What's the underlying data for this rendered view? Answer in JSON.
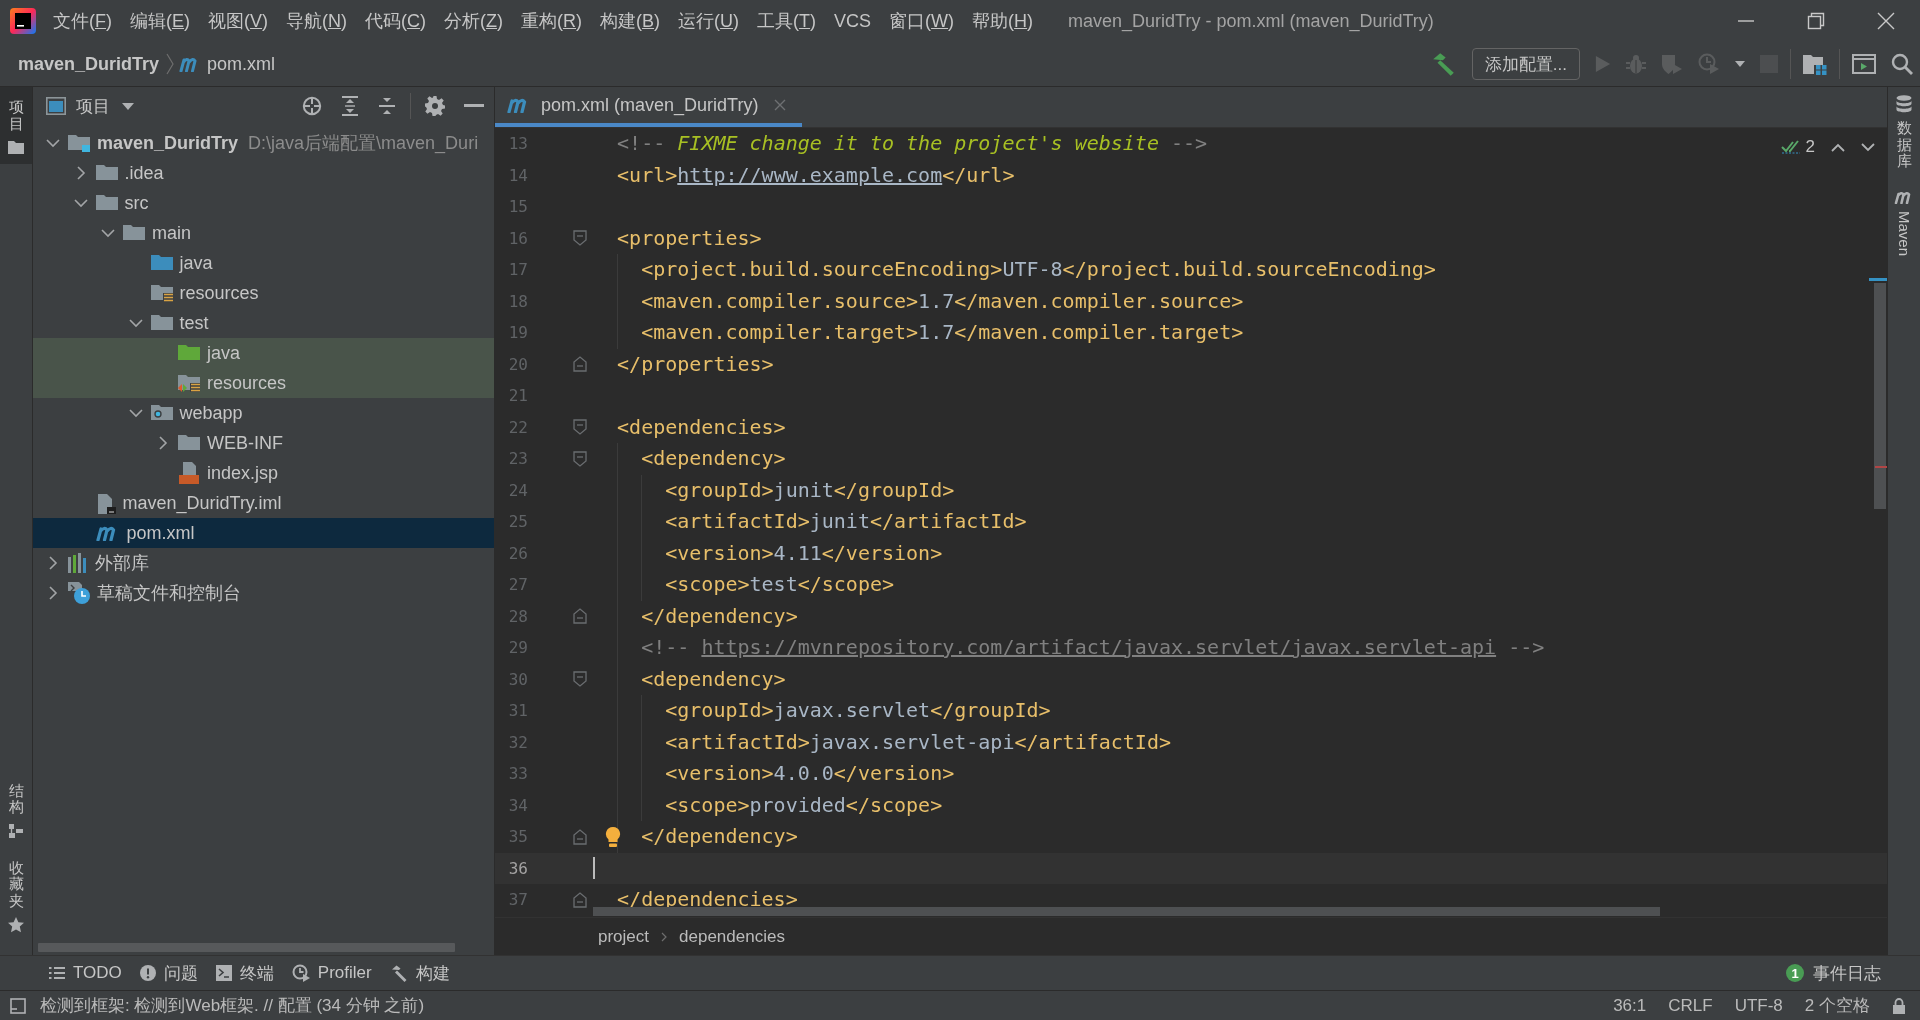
{
  "window": {
    "title": "maven_DuridTry - pom.xml (maven_DuridTry)"
  },
  "menu": [
    {
      "label": "文件(",
      "mnemonic": "F",
      "tail": ")"
    },
    {
      "label": "编辑(",
      "mnemonic": "E",
      "tail": ")"
    },
    {
      "label": "视图(",
      "mnemonic": "V",
      "tail": ")"
    },
    {
      "label": "导航(",
      "mnemonic": "N",
      "tail": ")"
    },
    {
      "label": "代码(",
      "mnemonic": "C",
      "tail": ")"
    },
    {
      "label": "分析(",
      "mnemonic": "Z",
      "tail": ")"
    },
    {
      "label": "重构(",
      "mnemonic": "R",
      "tail": ")"
    },
    {
      "label": "构建(",
      "mnemonic": "B",
      "tail": ")"
    },
    {
      "label": "运行(",
      "mnemonic": "U",
      "tail": ")"
    },
    {
      "label": "工具(",
      "mnemonic": "T",
      "tail": ")"
    },
    {
      "label": "VCS"
    },
    {
      "label": "窗口(",
      "mnemonic": "W",
      "tail": ")"
    },
    {
      "label": "帮助(",
      "mnemonic": "H",
      "tail": ")"
    }
  ],
  "navbar": {
    "breadcrumbs": [
      {
        "label": "maven_DuridTry",
        "kind": "project"
      },
      {
        "label": "pom.xml",
        "kind": "maven"
      }
    ],
    "toolbar_groups": [
      [
        {
          "kind": "build",
          "disabled": false
        },
        {
          "kind": "config",
          "label": "添加配置...",
          "disabled": false
        },
        {
          "kind": "run",
          "disabled": true
        },
        {
          "kind": "debug",
          "disabled": true
        },
        {
          "kind": "coverage",
          "disabled": true
        },
        {
          "kind": "profile",
          "disabled": true
        },
        {
          "kind": "dropdown",
          "disabled": false
        },
        {
          "kind": "stop",
          "disabled": true
        }
      ],
      [
        {
          "kind": "structure",
          "disabled": false
        }
      ],
      [
        {
          "kind": "window",
          "disabled": false
        },
        {
          "kind": "search",
          "disabled": false
        }
      ]
    ]
  },
  "left_strip": {
    "top": [
      {
        "label": "项目",
        "kind": "project",
        "selected": true
      }
    ],
    "bottom": [
      {
        "label": "结构",
        "kind": "structure",
        "selected": false
      },
      {
        "label": "收藏夹",
        "kind": "favorites",
        "selected": false
      }
    ]
  },
  "project_panel": {
    "title": "项目",
    "tool_groups": [
      [
        {
          "kind": "locate"
        },
        {
          "kind": "expand-all"
        },
        {
          "kind": "collapse-all"
        }
      ],
      [
        {
          "kind": "settings"
        },
        {
          "kind": "hide"
        }
      ]
    ],
    "tree": [
      {
        "name": "maven_DuridTry",
        "path": "D:\\java后端配置\\maven_Duri",
        "kind": "module",
        "expanded": true,
        "selected": false,
        "children": [
          {
            "name": ".idea",
            "kind": "folder",
            "expanded": false,
            "selected": false
          },
          {
            "name": "src",
            "kind": "folder",
            "expanded": true,
            "selected": false,
            "children": [
              {
                "name": "main",
                "kind": "folder",
                "expanded": true,
                "selected": false,
                "children": [
                  {
                    "name": "java",
                    "kind": "source-folder",
                    "selected": false
                  },
                  {
                    "name": "resources",
                    "kind": "resources-folder",
                    "selected": false
                  },
                  {
                    "name": "test",
                    "kind": "folder",
                    "expanded": true,
                    "selected": false,
                    "children": [
                      {
                        "name": "java",
                        "kind": "test-source-folder",
                        "selected": false
                      },
                      {
                        "name": "resources",
                        "kind": "test-resources-folder",
                        "selected": false
                      }
                    ]
                  },
                  {
                    "name": "webapp",
                    "kind": "web-folder",
                    "expanded": true,
                    "selected": false,
                    "children": [
                      {
                        "name": "WEB-INF",
                        "kind": "folder",
                        "expanded": false,
                        "selected": false
                      },
                      {
                        "name": "index.jsp",
                        "kind": "jsp",
                        "selected": false
                      }
                    ]
                  }
                ]
              }
            ]
          },
          {
            "name": "maven_DuridTry.iml",
            "kind": "iml",
            "selected": false
          },
          {
            "name": "pom.xml",
            "kind": "maven",
            "selected": true
          }
        ]
      },
      {
        "name": "外部库",
        "kind": "library",
        "expanded": false,
        "selected": false
      },
      {
        "name": "草稿文件和控制台",
        "kind": "scratches",
        "expanded": false,
        "selected": false
      }
    ]
  },
  "editor": {
    "tabs": [
      {
        "label": "pom.xml (maven_DuridTry)",
        "kind": "maven",
        "selected": true
      }
    ],
    "inspection": {
      "count": "2"
    },
    "lines": [
      {
        "number": "13",
        "current": false,
        "tokens": [
          {
            "kind": "comment",
            "text": "<!-- "
          },
          {
            "kind": "todo",
            "text": "FIXME change it to the project's website"
          },
          {
            "kind": "comment",
            "text": " -->"
          }
        ]
      },
      {
        "number": "14",
        "current": false,
        "tokens": [
          {
            "kind": "tag",
            "text": "<url>"
          },
          {
            "kind": "link",
            "text": "http://www.example.com"
          },
          {
            "kind": "tag",
            "text": "</url>"
          }
        ]
      },
      {
        "number": "15",
        "current": false
      },
      {
        "number": "16",
        "current": false,
        "gutter": [
          {
            "kind": "fold-start"
          }
        ],
        "tokens": [
          {
            "kind": "tag",
            "text": "<properties>"
          }
        ],
        "children": [
          {
            "number": "17",
            "current": false,
            "tokens": [
              {
                "kind": "tag",
                "text": "<project.build.sourceEncoding>"
              },
              {
                "kind": "text",
                "text": "UTF-8"
              },
              {
                "kind": "tag",
                "text": "</project.build.sourceEncoding>"
              }
            ]
          },
          {
            "number": "18",
            "current": false,
            "tokens": [
              {
                "kind": "tag",
                "text": "<maven.compiler.source>"
              },
              {
                "kind": "text",
                "text": "1.7"
              },
              {
                "kind": "tag",
                "text": "</maven.compiler.source>"
              }
            ]
          },
          {
            "number": "19",
            "current": false,
            "tokens": [
              {
                "kind": "tag",
                "text": "<maven.compiler.target>"
              },
              {
                "kind": "text",
                "text": "1.7"
              },
              {
                "kind": "tag",
                "text": "</maven.compiler.target>"
              }
            ]
          }
        ]
      },
      {
        "number": "20",
        "current": false,
        "gutter": [
          {
            "kind": "fold-end"
          }
        ],
        "tokens": [
          {
            "kind": "tag",
            "text": "</properties>"
          }
        ]
      },
      {
        "number": "21",
        "current": false
      },
      {
        "number": "22",
        "current": false,
        "gutter": [
          {
            "kind": "fold-start"
          }
        ],
        "tokens": [
          {
            "kind": "tag",
            "text": "<dependencies>"
          }
        ],
        "children": [
          {
            "number": "23",
            "current": false,
            "gutter": [
              {
                "kind": "fold-start"
              }
            ],
            "tokens": [
              {
                "kind": "tag",
                "text": "<dependency>"
              }
            ],
            "children": [
              {
                "number": "24",
                "current": false,
                "tokens": [
                  {
                    "kind": "tag",
                    "text": "<groupId>"
                  },
                  {
                    "kind": "text",
                    "text": "junit"
                  },
                  {
                    "kind": "tag",
                    "text": "</groupId>"
                  }
                ]
              },
              {
                "number": "25",
                "current": false,
                "tokens": [
                  {
                    "kind": "tag",
                    "text": "<artifactId>"
                  },
                  {
                    "kind": "text",
                    "text": "junit"
                  },
                  {
                    "kind": "tag",
                    "text": "</artifactId>"
                  }
                ]
              },
              {
                "number": "26",
                "current": false,
                "tokens": [
                  {
                    "kind": "tag",
                    "text": "<version>"
                  },
                  {
                    "kind": "text",
                    "text": "4.11"
                  },
                  {
                    "kind": "tag",
                    "text": "</version>"
                  }
                ]
              },
              {
                "number": "27",
                "current": false,
                "tokens": [
                  {
                    "kind": "tag",
                    "text": "<scope>"
                  },
                  {
                    "kind": "text",
                    "text": "test"
                  },
                  {
                    "kind": "tag",
                    "text": "</scope>"
                  }
                ]
              }
            ]
          },
          {
            "number": "28",
            "current": false,
            "gutter": [
              {
                "kind": "fold-end"
              }
            ],
            "tokens": [
              {
                "kind": "tag",
                "text": "</dependency>"
              }
            ]
          },
          {
            "number": "29",
            "current": false,
            "tokens": [
              {
                "kind": "comment",
                "text": "<!-- "
              },
              {
                "kind": "comment-link",
                "text": "https://mvnrepository.com/artifact/javax.servlet/javax.servlet-api"
              },
              {
                "kind": "comment",
                "text": " -->"
              }
            ]
          },
          {
            "number": "30",
            "current": false,
            "gutter": [
              {
                "kind": "fold-start"
              }
            ],
            "tokens": [
              {
                "kind": "tag",
                "text": "<dependency>"
              }
            ],
            "children": [
              {
                "number": "31",
                "current": false,
                "tokens": [
                  {
                    "kind": "tag",
                    "text": "<groupId>"
                  },
                  {
                    "kind": "text",
                    "text": "javax.servlet"
                  },
                  {
                    "kind": "tag",
                    "text": "</groupId>"
                  }
                ]
              },
              {
                "number": "32",
                "current": false,
                "tokens": [
                  {
                    "kind": "tag",
                    "text": "<artifactId>"
                  },
                  {
                    "kind": "text",
                    "text": "javax.servlet-api"
                  },
                  {
                    "kind": "tag",
                    "text": "</artifactId>"
                  }
                ]
              },
              {
                "number": "33",
                "current": false,
                "tokens": [
                  {
                    "kind": "tag",
                    "text": "<version>"
                  },
                  {
                    "kind": "text",
                    "text": "4.0.0"
                  },
                  {
                    "kind": "tag",
                    "text": "</version>"
                  }
                ]
              },
              {
                "number": "34",
                "current": false,
                "tokens": [
                  {
                    "kind": "tag",
                    "text": "<scope>"
                  },
                  {
                    "kind": "text",
                    "text": "provided"
                  },
                  {
                    "kind": "tag",
                    "text": "</scope>"
                  }
                ]
              }
            ]
          },
          {
            "number": "35",
            "current": false,
            "gutter": [
              {
                "kind": "fold-end"
              },
              {
                "kind": "bulb"
              }
            ],
            "tokens": [
              {
                "kind": "tag",
                "text": "</dependency>"
              }
            ]
          },
          {
            "number": "36",
            "current": true
          }
        ]
      },
      {
        "number": "37",
        "current": false,
        "gutter": [
          {
            "kind": "fold-end"
          }
        ],
        "tokens": [
          {
            "kind": "tag",
            "text": "</dependencies>"
          }
        ]
      }
    ],
    "breadcrumbs": [
      "project",
      "dependencies"
    ]
  },
  "right_strip": [
    {
      "label": "数据库",
      "kind": "database",
      "selected": false
    },
    {
      "label": "Maven",
      "kind": "maven",
      "selected": false
    }
  ],
  "tool_windows": [
    {
      "label": "TODO",
      "kind": "todo",
      "selected": false
    },
    {
      "label": "问题",
      "kind": "problems",
      "selected": false
    },
    {
      "label": "终端",
      "kind": "terminal",
      "selected": false
    },
    {
      "label": "Profiler",
      "kind": "profiler",
      "selected": false
    },
    {
      "label": "构建",
      "kind": "build",
      "selected": false
    }
  ],
  "event_log": {
    "label": "事件日志",
    "count": "1"
  },
  "status_bar": {
    "message": "检测到框架: 检测到Web框架. // 配置 (34 分钟 之前)",
    "items": [
      "36:1",
      "CRLF",
      "UTF-8",
      "2 个空格"
    ]
  }
}
